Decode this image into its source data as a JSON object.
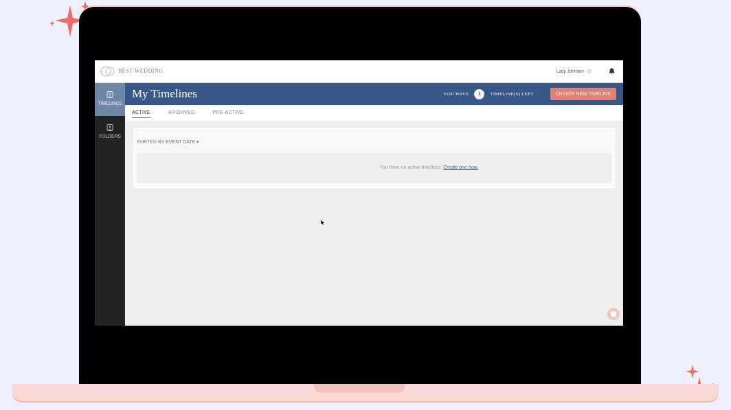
{
  "header": {
    "brand": "BEST WEDDING",
    "user": "Lacy Johnson"
  },
  "sidebar": {
    "items": [
      {
        "label": "TIMELINES",
        "selected": true
      },
      {
        "label": "FOLDERS",
        "selected": false
      }
    ]
  },
  "page": {
    "title": "My Timelines",
    "quota_prefix": "YOU HAVE",
    "quota_count": "1",
    "quota_suffix": "TIMELINE(S) LEFT",
    "create_button": "CREATE NEW TIMELINE"
  },
  "tabs": [
    {
      "label": "ACTIVE",
      "selected": true
    },
    {
      "label": "ARCHIVED",
      "selected": false
    },
    {
      "label": "PRE-ACTIVE",
      "selected": false
    }
  ],
  "list": {
    "sort": "SORTED BY EVENT DATE ▾",
    "empty_text": "You have no active timelines.",
    "empty_link": "Create one now."
  }
}
